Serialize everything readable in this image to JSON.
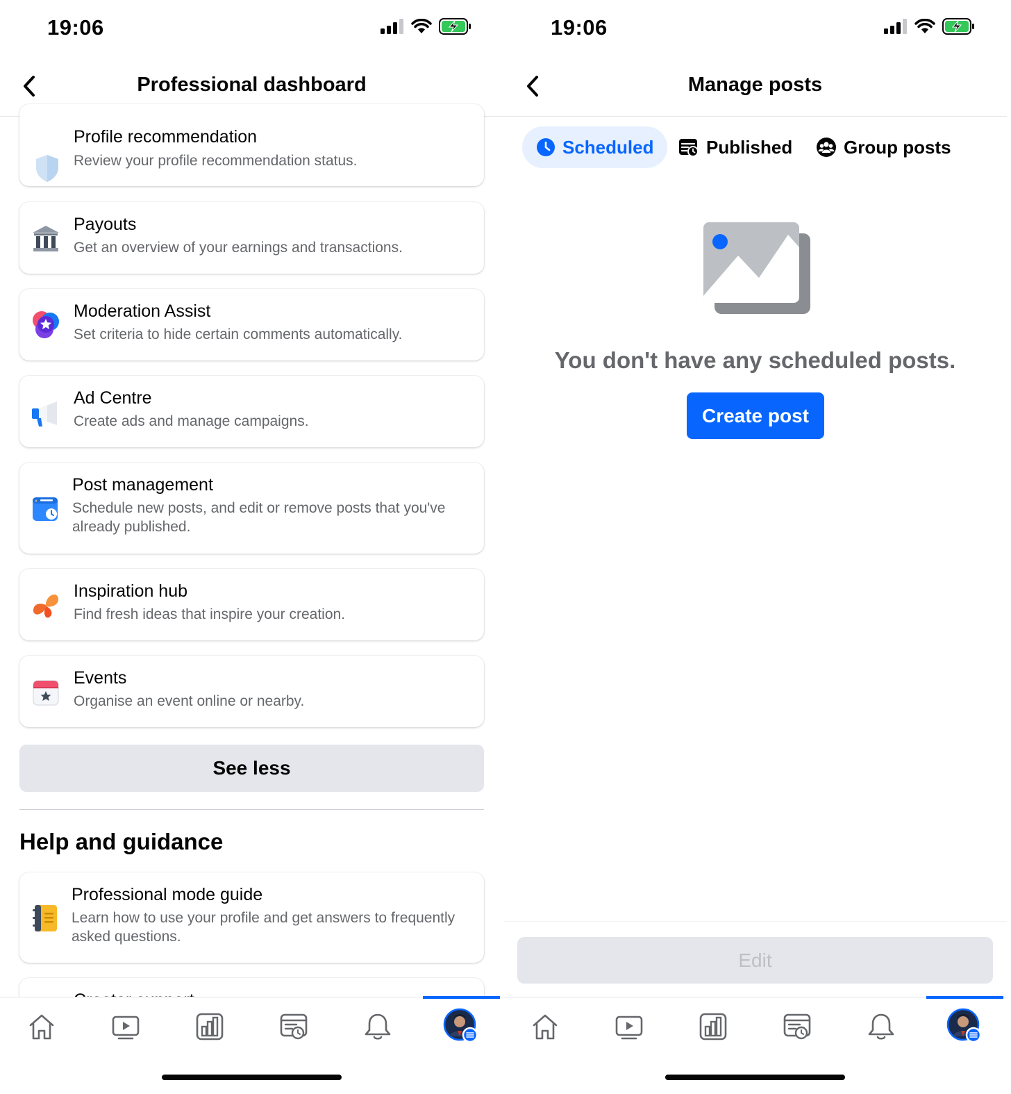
{
  "status_bar": {
    "time": "19:06"
  },
  "left_screen": {
    "title": "Professional dashboard",
    "tools": [
      {
        "title": "Profile recommendation",
        "subtitle": "Review your profile recommendation status.",
        "icon": "shield-icon"
      },
      {
        "title": "Payouts",
        "subtitle": "Get an overview of your earnings and transactions.",
        "icon": "bank-icon"
      },
      {
        "title": "Moderation Assist",
        "subtitle": "Set criteria to hide certain comments automatically.",
        "icon": "star-badge-icon"
      },
      {
        "title": "Ad Centre",
        "subtitle": "Create ads and manage campaigns.",
        "icon": "megaphone-icon"
      },
      {
        "title": "Post management",
        "subtitle": "Schedule new posts, and edit or remove posts that you've already published.",
        "icon": "calendar-clock-icon"
      },
      {
        "title": "Inspiration hub",
        "subtitle": "Find fresh ideas that inspire your creation.",
        "icon": "butterfly-icon"
      },
      {
        "title": "Events",
        "subtitle": "Organise an event online or nearby.",
        "icon": "calendar-star-icon"
      }
    ],
    "see_less_label": "See less",
    "help_section": {
      "title": "Help and guidance",
      "items": [
        {
          "title": "Professional mode guide",
          "subtitle": "Learn how to use your profile and get answers to frequently asked questions.",
          "icon": "notebook-icon"
        },
        {
          "title": "Creator support",
          "subtitle": "",
          "icon": ""
        }
      ]
    }
  },
  "right_screen": {
    "title": "Manage posts",
    "tabs": [
      {
        "label": "Scheduled",
        "icon": "clock-icon",
        "active": true
      },
      {
        "label": "Published",
        "icon": "published-icon",
        "active": false
      },
      {
        "label": "Group posts",
        "icon": "group-icon",
        "active": false
      }
    ],
    "empty_message": "You don't have any scheduled posts.",
    "create_post_label": "Create post",
    "edit_label": "Edit"
  },
  "bottom_nav": [
    "home-icon",
    "video-icon",
    "dashboard-icon",
    "feeds-icon",
    "bell-icon",
    "profile-avatar"
  ],
  "colors": {
    "accent": "#0866ff",
    "secondary_text": "#65676b",
    "button_gray": "#e4e6eb"
  }
}
